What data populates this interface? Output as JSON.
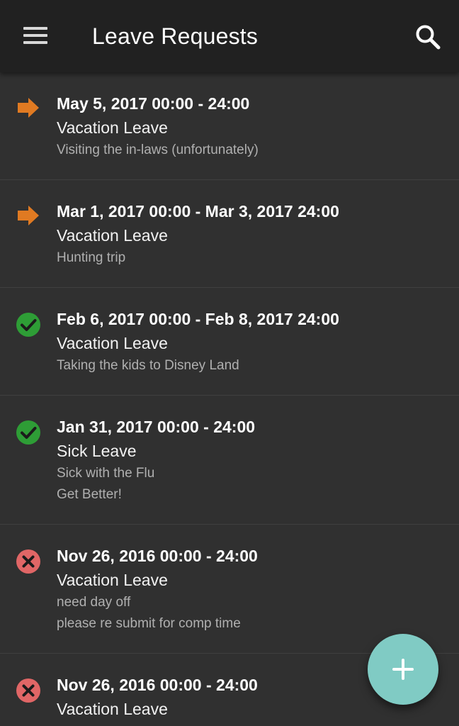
{
  "toolbar": {
    "title": "Leave Requests",
    "menu_icon": "hamburger-menu-icon",
    "search_icon": "search-icon"
  },
  "status_colors": {
    "pending": "#e07a22",
    "approved": "#2e9d36",
    "rejected": "#e06666"
  },
  "requests": [
    {
      "status": "pending",
      "status_icon": "arrow-right-icon",
      "date": "May 5, 2017 00:00 - 24:00",
      "type": "Vacation Leave",
      "note": "Visiting the in-laws (unfortunately)",
      "response": ""
    },
    {
      "status": "pending",
      "status_icon": "arrow-right-icon",
      "date": "Mar 1, 2017 00:00 - Mar 3, 2017 24:00",
      "type": "Vacation Leave",
      "note": "Hunting trip",
      "response": ""
    },
    {
      "status": "approved",
      "status_icon": "check-circle-icon",
      "date": "Feb 6, 2017 00:00 - Feb 8, 2017 24:00",
      "type": "Vacation Leave",
      "note": "Taking the kids to Disney Land",
      "response": ""
    },
    {
      "status": "approved",
      "status_icon": "check-circle-icon",
      "date": "Jan 31, 2017 00:00 - 24:00",
      "type": "Sick Leave",
      "note": "Sick with the Flu",
      "response": "Get Better!"
    },
    {
      "status": "rejected",
      "status_icon": "x-circle-icon",
      "date": "Nov 26, 2016 00:00 - 24:00",
      "type": "Vacation Leave",
      "note": "need day off",
      "response": "please re submit for comp time"
    },
    {
      "status": "rejected",
      "status_icon": "x-circle-icon",
      "date": "Nov 26, 2016 00:00 - 24:00",
      "type": "Vacation Leave",
      "note": "",
      "response": ""
    }
  ],
  "fab": {
    "icon": "plus-icon",
    "color": "#80cbc4"
  }
}
